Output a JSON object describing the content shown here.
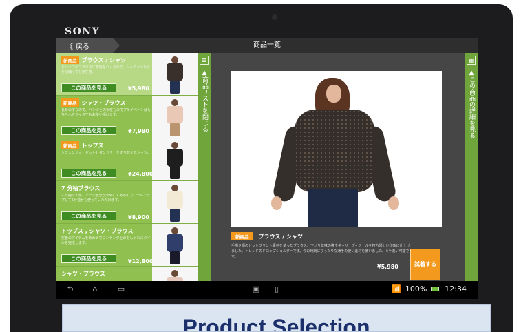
{
  "device": {
    "brand": "SONY"
  },
  "header": {
    "back_label": "戻る",
    "title": "商品一覧"
  },
  "sidebar": {
    "collapse_label": "商品リストを閉じる",
    "detail_label": "この商品の詳細を見る"
  },
  "products": [
    {
      "tag": "新商品",
      "title": "ブラウス / シャツ",
      "desc": "ドレープがブラウスに表情をつくるので、ジャケットなどを羽織っても存在感。",
      "button": "この商品を見る",
      "price": "¥5,980"
    },
    {
      "tag": "新商品",
      "title": "シャツ・ブラウス",
      "desc": "長めのすなので、パンツとの相性ものでプライベートはもちろんオフィスでもお使い頂けます。",
      "button": "この商品を見る",
      "price": "¥7,980"
    },
    {
      "tag": "新商品",
      "title": "トップス",
      "desc": "シフォンジョーゼットとダンガリーを切り替えたシャツ。",
      "button": "この商品を見る",
      "price": "¥24,800"
    },
    {
      "tag": "",
      "title": "7 分袖ブラウス",
      "desc": "7 分袖ですが、アーム部分が大めにてあるのでロールアップして5分袖かも使っていただけます。",
      "button": "この商品を見る",
      "price": "¥8,900"
    },
    {
      "tag": "",
      "title": "トップス , シャツ・ブラウス",
      "desc": "定番のアイテムをあわせでワンランク上のおしゃれスタイルを完成します。",
      "button": "この商品を見る",
      "price": "¥12,800"
    },
    {
      "tag": "",
      "title": "シャツ・ブラウス",
      "desc": "",
      "button": "",
      "price": ""
    }
  ],
  "selected": {
    "tag": "新商品",
    "title": "ブラウス / シャツ",
    "desc": "手描き調のドットプリント素材を使ったブラウス。下がり気味の襟やギャザーディテールを打ち優しい印象に仕上げました。トレンドのドロップショルダーです。今の時期にぴったりな薄手の使い素材を使いました。※手洗い可能です。",
    "price": "¥5,980",
    "try_button": "試着する"
  },
  "statusbar": {
    "battery": "100%",
    "time": "12:34"
  },
  "caption": "Product Selection",
  "colors": {
    "green": "#8fc050",
    "dark_green": "#3e8c22",
    "orange": "#f39a1e",
    "main_bg": "#464646"
  },
  "icons": [
    "back-nav-icon",
    "home-nav-icon",
    "recent-apps-icon",
    "menu-icon",
    "grid-icon",
    "signal-icon",
    "battery-icon"
  ]
}
